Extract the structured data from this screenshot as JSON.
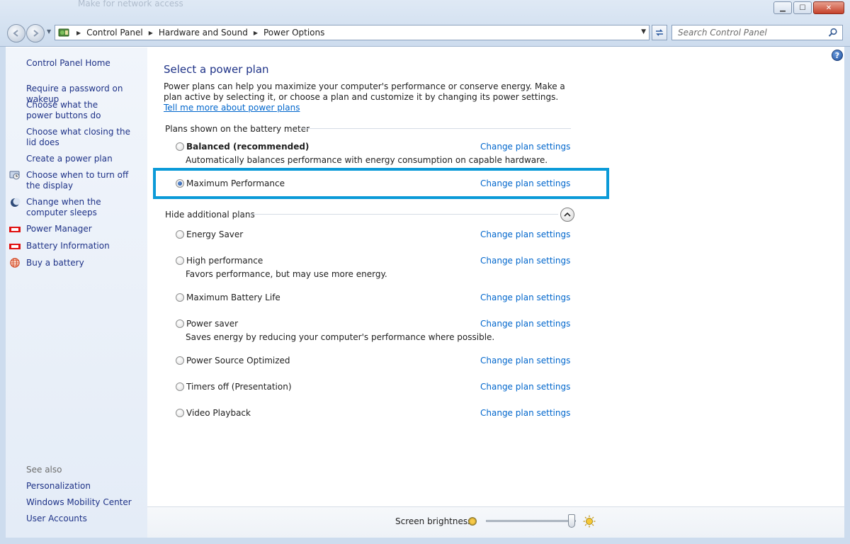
{
  "window": {
    "faded_background_text": "Make for network access",
    "minimize_label": "▁",
    "maximize_label": "☐",
    "close_label": "✕"
  },
  "address_bar": {
    "breadcrumbs": [
      "Control Panel",
      "Hardware and Sound",
      "Power Options"
    ],
    "search_placeholder": "Search Control Panel"
  },
  "sidebar": {
    "home": "Control Panel Home",
    "links": [
      {
        "label": "Require a password on wakeup",
        "icon": null
      },
      {
        "label": "Choose what the power buttons do",
        "icon": null
      },
      {
        "label": "Choose what closing the lid does",
        "icon": null
      },
      {
        "label": "Create a power plan",
        "icon": null
      },
      {
        "label": "Choose when to turn off the display",
        "icon": "display-icon"
      },
      {
        "label": "Change when the computer sleeps",
        "icon": "moon-icon"
      },
      {
        "label": "Power Manager",
        "icon": "power-manager-icon"
      },
      {
        "label": "Battery Information",
        "icon": "battery-info-icon"
      },
      {
        "label": "Buy a battery",
        "icon": "globe-icon"
      }
    ],
    "see_also": {
      "heading": "See also",
      "links": [
        "Personalization",
        "Windows Mobility Center",
        "User Accounts"
      ]
    }
  },
  "main": {
    "title": "Select a power plan",
    "intro_text": "Power plans can help you maximize your computer's performance or conserve energy. Make a plan active by selecting it, or choose a plan and customize it by changing its power settings.",
    "intro_link": "Tell me more about power plans",
    "group_shown": "Plans shown on the battery meter",
    "group_hidden": "Hide additional plans",
    "change_label": "Change plan settings",
    "shown_plans": [
      {
        "name": "Balanced (recommended)",
        "description": "Automatically balances performance with energy consumption on capable hardware.",
        "selected": false,
        "bold": true
      },
      {
        "name": "Maximum Performance",
        "description": "",
        "selected": true,
        "bold": false
      }
    ],
    "hidden_plans": [
      {
        "name": "Energy Saver",
        "description": "",
        "selected": false
      },
      {
        "name": "High performance",
        "description": "Favors performance, but may use more energy.",
        "selected": false
      },
      {
        "name": "Maximum Battery Life",
        "description": "",
        "selected": false
      },
      {
        "name": "Power saver",
        "description": "Saves energy by reducing your computer's performance where possible.",
        "selected": false
      },
      {
        "name": "Power Source Optimized",
        "description": "",
        "selected": false
      },
      {
        "name": "Timers off (Presentation)",
        "description": "",
        "selected": false
      },
      {
        "name": "Video Playback",
        "description": "",
        "selected": false
      }
    ]
  },
  "bottom_bar": {
    "brightness_label": "Screen brightness:",
    "brightness_level": 1.0
  },
  "colors": {
    "highlight_border": "#0b9ad8",
    "link": "#0066cc",
    "title": "#1e3287"
  }
}
